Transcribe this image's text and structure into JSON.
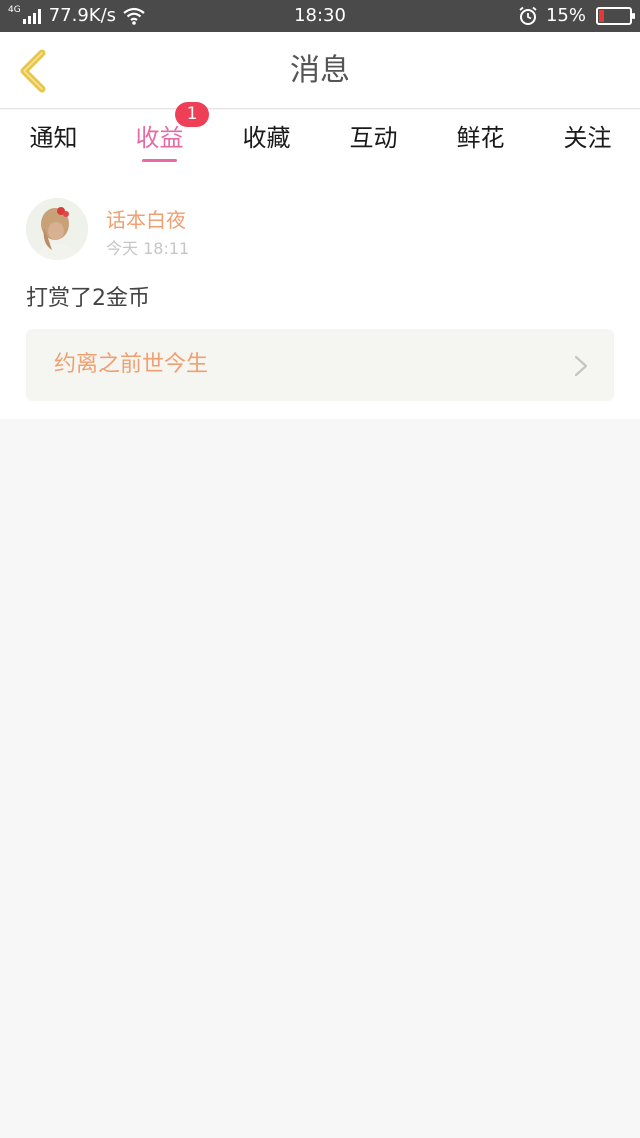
{
  "status_bar": {
    "network": "4G",
    "speed": "77.9K/s",
    "time": "18:30",
    "battery": "15%",
    "battery_level": 0.15,
    "battery_color": "#e53935",
    "icons": [
      "signal-icon",
      "wifi-icon",
      "alarm-icon",
      "battery-icon"
    ]
  },
  "header": {
    "title": "消息",
    "back_icon": "chevron-left-icon",
    "back_icon_color": "#e8c64a"
  },
  "tabs": [
    {
      "label": "通知"
    },
    {
      "label": "收益",
      "badge": "1",
      "active": true
    },
    {
      "label": "收藏"
    },
    {
      "label": "互动"
    },
    {
      "label": "鲜花"
    },
    {
      "label": "关注"
    }
  ],
  "accent_color": "#e86aa2",
  "message": {
    "user": "话本白夜",
    "time": "今天 18:11",
    "text": "打赏了2金币",
    "book_title": "约离之前世今生",
    "link_icon": "chevron-right-icon"
  }
}
